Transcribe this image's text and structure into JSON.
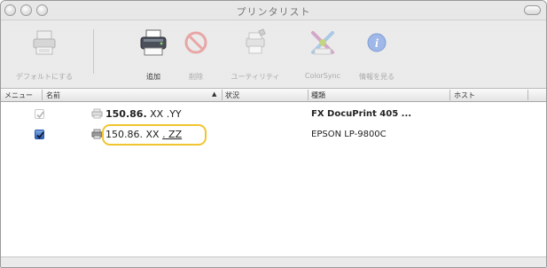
{
  "window": {
    "title": "プリンタリスト"
  },
  "toolbar": {
    "items": [
      {
        "label": "デフォルトにする",
        "enabled": false,
        "icon": "printer-default-icon"
      },
      {
        "label": "追加",
        "enabled": true,
        "icon": "add-printer-icon"
      },
      {
        "label": "削除",
        "enabled": false,
        "icon": "delete-icon"
      },
      {
        "label": "ユーティリティ",
        "enabled": false,
        "icon": "utility-icon"
      },
      {
        "label": "ColorSync",
        "enabled": false,
        "icon": "colorsync-icon"
      },
      {
        "label": "情報を見る",
        "enabled": false,
        "icon": "info-icon"
      }
    ]
  },
  "columns": {
    "menu": "メニュー",
    "name": "名前",
    "status": "状況",
    "kind": "種類",
    "host": "ホスト"
  },
  "printers": [
    {
      "in_menu": true,
      "checkbox_dimmed": true,
      "name_bold": "150.86.",
      "name_mid": " XX ",
      "name_tail": ".YY",
      "kind": "FX DocuPrint 405 ...",
      "kind_bold": true
    },
    {
      "in_menu": true,
      "checkbox_dimmed": false,
      "name_bold": "",
      "name_mid": "150.86. XX ",
      "name_tail": ". ZZ",
      "kind": "EPSON LP-9800C",
      "kind_bold": false
    }
  ],
  "colors": {
    "highlight": "#f2c530",
    "checkbox": "#2f5fb3"
  }
}
